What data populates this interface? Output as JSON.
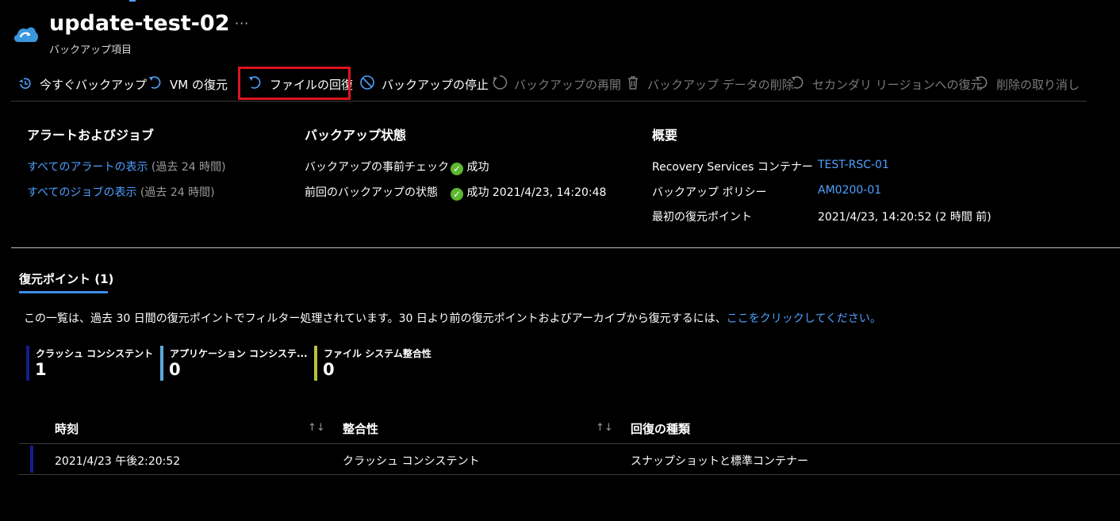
{
  "header": {
    "title": "update-test-02",
    "subtitle": "バックアップ項目",
    "more": "···",
    "icon": "cloud-backup-icon"
  },
  "toolbar": {
    "items": [
      {
        "label": "今すぐバックアップ",
        "icon": "backup-now-icon",
        "enabled": true
      },
      {
        "label": "VM の復元",
        "icon": "restore-icon",
        "enabled": true
      },
      {
        "label": "ファイルの回復",
        "icon": "restore-icon",
        "enabled": true,
        "highlighted": true
      },
      {
        "label": "バックアップの停止",
        "icon": "stop-icon",
        "enabled": true
      },
      {
        "label": "バックアップの再開",
        "icon": "resume-icon",
        "enabled": false
      },
      {
        "label": "バックアップ データの削除",
        "icon": "trash-icon",
        "enabled": false
      },
      {
        "label": "セカンダリ リージョンへの復元",
        "icon": "restore-icon",
        "enabled": false
      },
      {
        "label": "削除の取り消し",
        "icon": "undo-icon",
        "enabled": false
      }
    ]
  },
  "alerts": {
    "heading": "アラートおよびジョブ",
    "alerts_link": "すべてのアラートの表示",
    "alerts_range": "(過去 24 時間)",
    "jobs_link": "すべてのジョブの表示",
    "jobs_range": "(過去 24 時間)"
  },
  "backup_status": {
    "heading": "バックアップ状態",
    "precheck_label": "バックアップの事前チェック",
    "precheck_value": "成功",
    "last_label": "前回のバックアップの状態",
    "last_value": "成功 2021/4/23, 14:20:48"
  },
  "overview": {
    "heading": "概要",
    "vault_label": "Recovery Services コンテナー",
    "vault_value": "TEST-RSC-01",
    "policy_label": "バックアップ ポリシー",
    "policy_value": "AM0200-01",
    "first_label": "最初の復元ポイント",
    "first_value": "2021/4/23, 14:20:52 (2 時間 前)"
  },
  "restore_points": {
    "tab_label": "復元ポイント (1)",
    "notice": "この一覧は、過去 30 日間の復元ポイントでフィルター処理されています。30 日より前の復元ポイントおよびアーカイブから復元するには、",
    "notice_link": "ここをクリックしてください。",
    "stats": [
      {
        "label": "クラッシュ コンシステント",
        "value": "1",
        "color": "#141e8c"
      },
      {
        "label": "アプリケーション コンシステ...",
        "value": "0",
        "color": "#5aa8d8"
      },
      {
        "label": "ファイル システム整合性",
        "value": "0",
        "color": "#b9c23a"
      }
    ],
    "columns": [
      "時刻",
      "整合性",
      "回復の種類"
    ],
    "rows": [
      {
        "time": "2021/4/23 午後2:20:52",
        "consistency": "クラッシュ コンシステント",
        "type": "スナップショットと標準コンテナー"
      }
    ]
  }
}
